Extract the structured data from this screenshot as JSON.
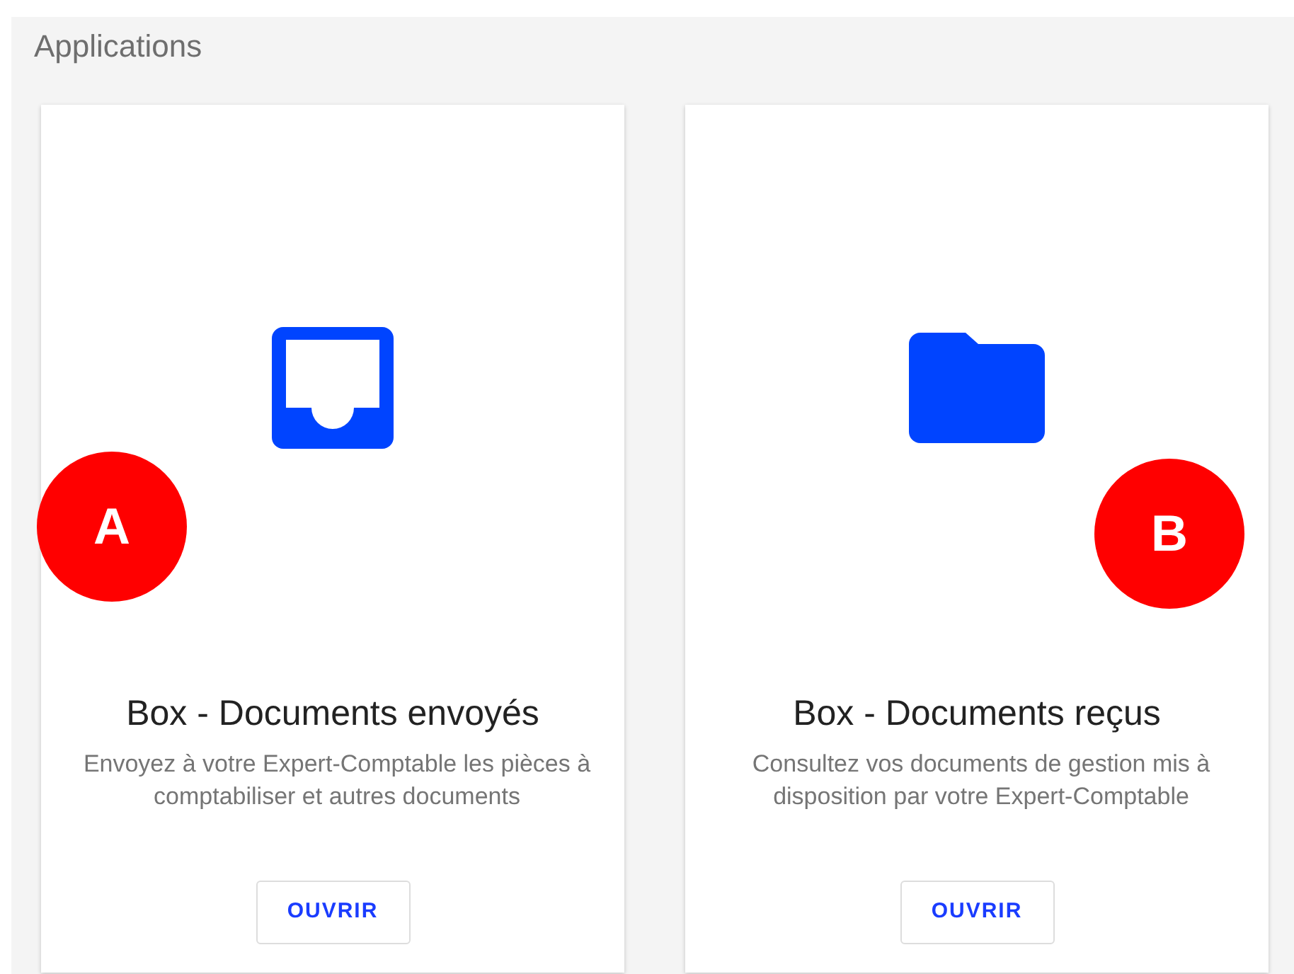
{
  "section": {
    "title": "Applications"
  },
  "cards": [
    {
      "kind": "tray",
      "title": "Box - Documents envoyés",
      "description": "Envoyez à votre Expert-Comptable les pièces à comptabiliser et autres documents",
      "button": "OUVRIR",
      "marker": "A"
    },
    {
      "kind": "folder",
      "title": "Box - Documents reçus",
      "description": "Consultez vos documents de gestion mis à disposition par votre Expert-Comptable",
      "button": "OUVRIR",
      "marker": "B"
    }
  ]
}
